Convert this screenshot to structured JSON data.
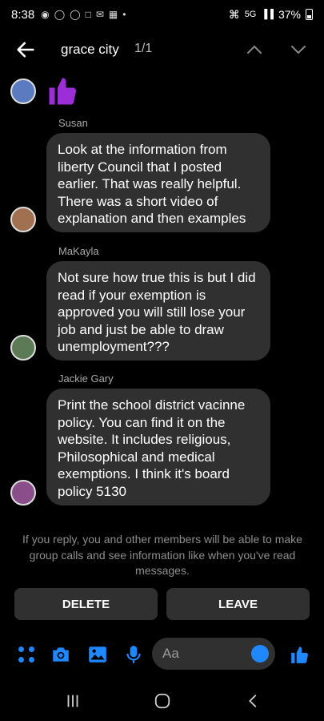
{
  "status_bar": {
    "time": "8:38",
    "network": "5G",
    "battery": "37%",
    "notification_icons": [
      "snapchat-icon",
      "facebook-icon",
      "pinterest-icon",
      "app-icon",
      "gmail-icon",
      "apps-icon",
      "dot-icon"
    ]
  },
  "header": {
    "title": "grace city",
    "result_count": "1/1",
    "icons": [
      "back-arrow-icon",
      "chevron-up-icon",
      "chevron-down-icon"
    ]
  },
  "messages": [
    {
      "sender": "",
      "type": "reaction",
      "icon": "thumbs-up-icon",
      "reaction_color": "#9b2ed6"
    },
    {
      "sender": "Susan",
      "text": "Look at the information from liberty Council that I posted earlier. That was really helpful. There was a short video of explanation and then examples"
    },
    {
      "sender": "MaKayla",
      "text": "Not sure how true this is but I did read if your exemption is approved you will still lose your job and just be able to draw unemployment???"
    },
    {
      "sender": "Jackie Gary",
      "text": "Print the school district vacinne policy. You can find it on the website. It includes religious, Philosophical and medical exemptions.  I think it's board policy 5130"
    }
  ],
  "notice": "If you reply, you and other members will be able to make group calls and see information like when you've read messages.",
  "actions": {
    "delete_label": "DELETE",
    "leave_label": "LEAVE"
  },
  "composer": {
    "placeholder": "Aa",
    "icons": [
      "menu-dots-icon",
      "camera-icon",
      "gallery-icon",
      "microphone-icon",
      "emoji-icon",
      "like-icon"
    ],
    "accent": "#1f87ff"
  },
  "navigation": {
    "icons": [
      "recents-icon",
      "home-icon",
      "back-icon"
    ]
  }
}
